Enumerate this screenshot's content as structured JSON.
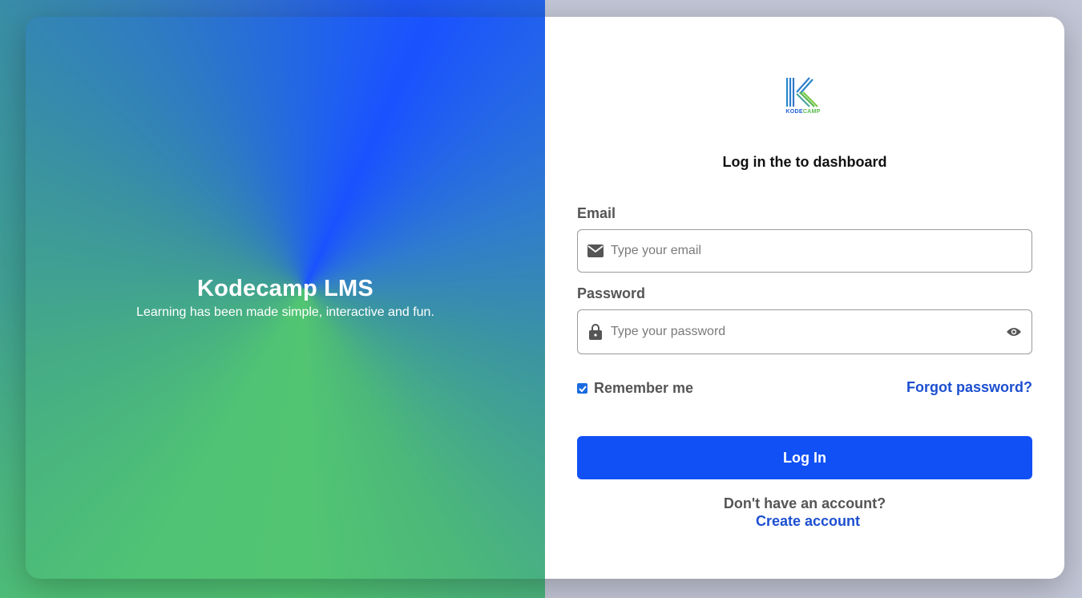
{
  "hero": {
    "title": "Kodecamp LMS",
    "subtitle": "Learning has been made simple, interactive and fun."
  },
  "logo": {
    "wordmark_main": "KODE",
    "wordmark_accent": "CAMP"
  },
  "login": {
    "heading": "Log in the to dashboard",
    "email_label": "Email",
    "email_placeholder": "Type your email",
    "password_label": "Password",
    "password_placeholder": "Type your password",
    "remember_label": "Remember me",
    "remember_checked": true,
    "forgot_label": "Forgot password?",
    "submit_label": "Log In",
    "signup_question": "Don't have an account?",
    "signup_link": "Create account"
  },
  "icons": {
    "email": "envelope-icon",
    "password": "lock-icon",
    "toggle_visibility": "eye-icon",
    "checkbox": "check-icon"
  },
  "colors": {
    "primary": "#1150f5",
    "link": "#1c4fd0",
    "label": "#555555",
    "logo_blue": "#1f5fd6",
    "logo_green": "#55b94b"
  }
}
